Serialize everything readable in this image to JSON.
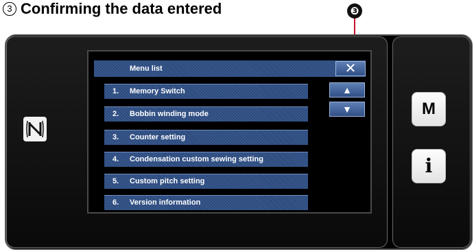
{
  "heading": {
    "number": "3",
    "text": "Confirming the data entered"
  },
  "callout": {
    "label": "❸"
  },
  "screen": {
    "title": "Menu list",
    "close_label": "✕",
    "up_label": "▲",
    "down_label": "▼",
    "items": [
      {
        "index": "1.",
        "label": "Memory Switch"
      },
      {
        "index": "2.",
        "label": "Bobbin winding mode"
      },
      {
        "index": "3.",
        "label": "Counter setting"
      },
      {
        "index": "4.",
        "label": "Condensation custom sewing setting"
      },
      {
        "index": "5.",
        "label": "Custom pitch setting"
      },
      {
        "index": "6.",
        "label": "Version information"
      }
    ]
  },
  "side_buttons": {
    "menu_label": "M",
    "info_label": "i"
  }
}
